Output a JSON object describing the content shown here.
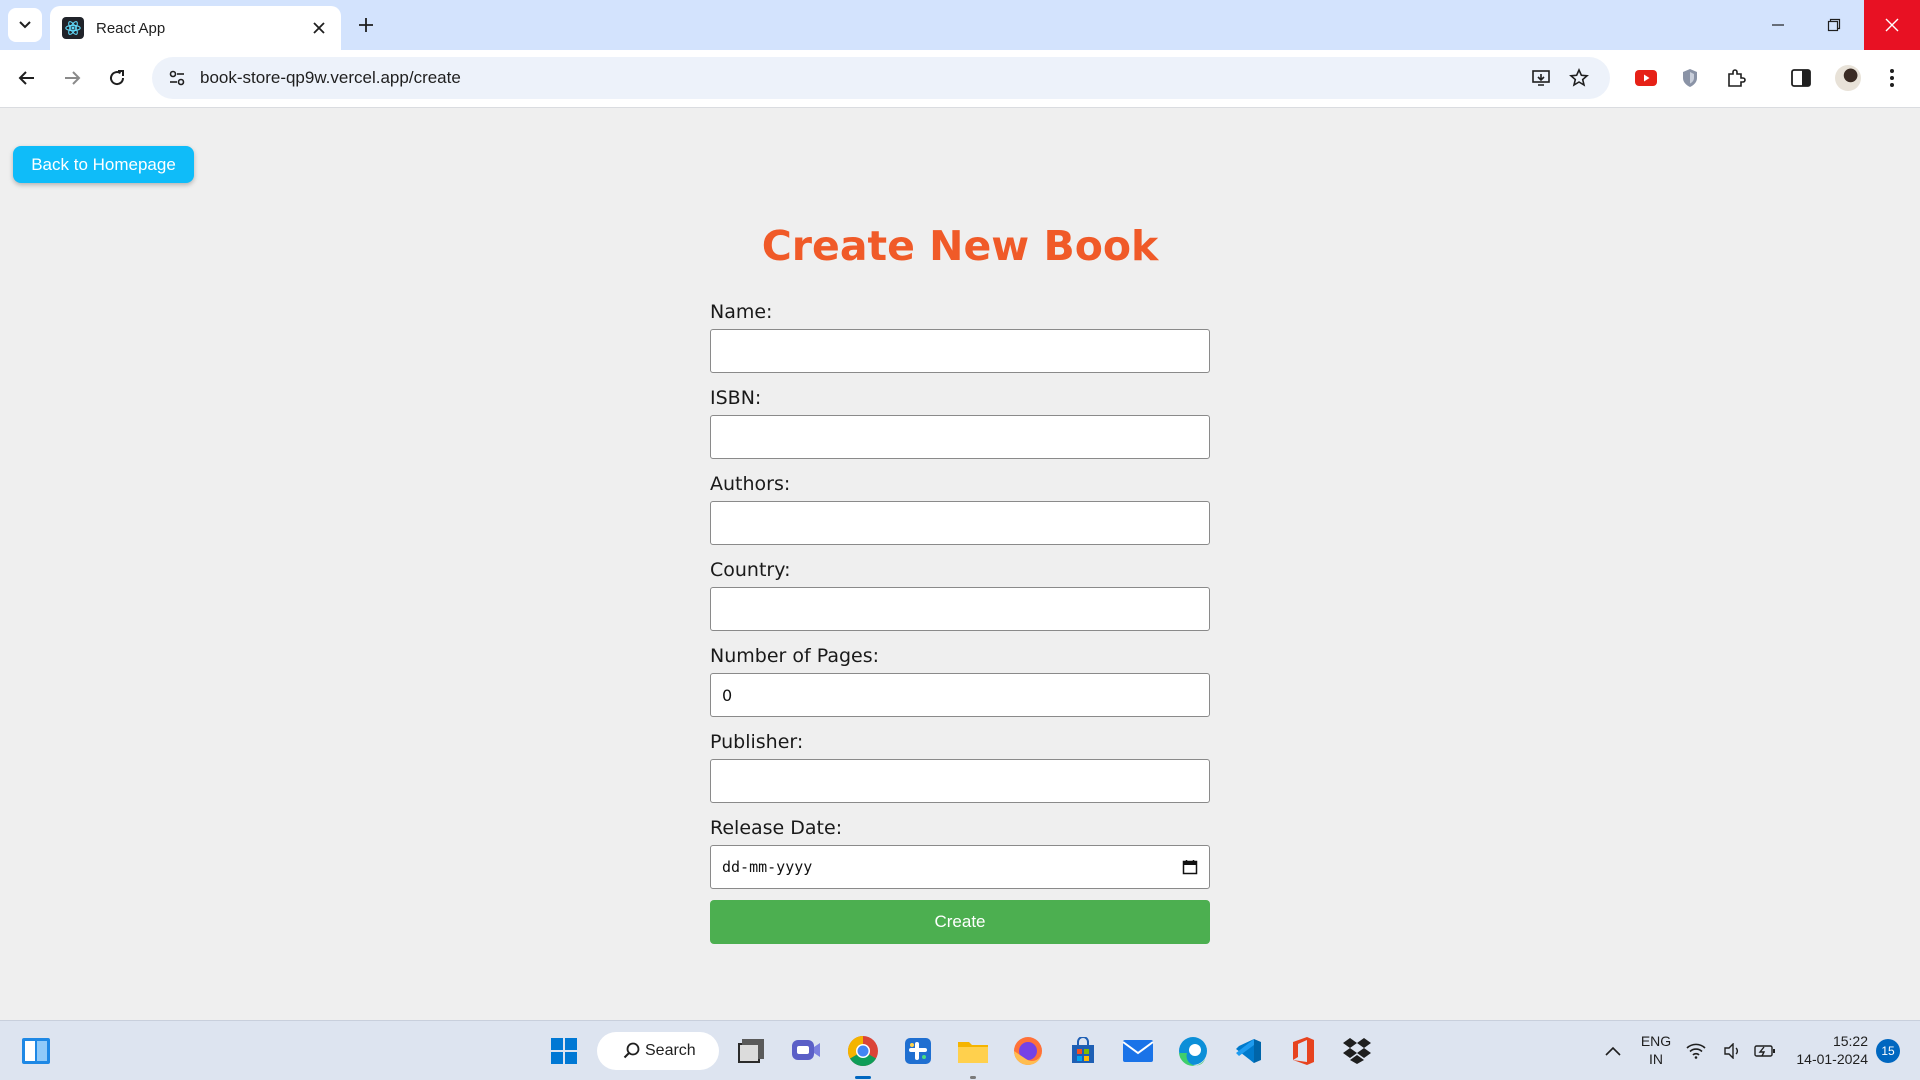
{
  "browser": {
    "tab_title": "React App",
    "url": "book-store-qp9w.vercel.app/create"
  },
  "page": {
    "back_button": "Back to Homepage",
    "title": "Create New Book",
    "fields": {
      "name": {
        "label": "Name:",
        "value": ""
      },
      "isbn": {
        "label": "ISBN:",
        "value": ""
      },
      "authors": {
        "label": "Authors:",
        "value": ""
      },
      "country": {
        "label": "Country:",
        "value": ""
      },
      "pages": {
        "label": "Number of Pages:",
        "value": "0"
      },
      "publisher": {
        "label": "Publisher:",
        "value": ""
      },
      "release_date": {
        "label": "Release Date:",
        "placeholder": "dd-mm-yyyy"
      }
    },
    "submit_label": "Create"
  },
  "taskbar": {
    "search_label": "Search",
    "language": "ENG",
    "region": "IN",
    "time": "15:22",
    "date": "14-01-2024",
    "notification_count": "15"
  },
  "colors": {
    "title": "#f05a28",
    "back_button": "#0fbcf9",
    "create_button": "#4caf50"
  }
}
